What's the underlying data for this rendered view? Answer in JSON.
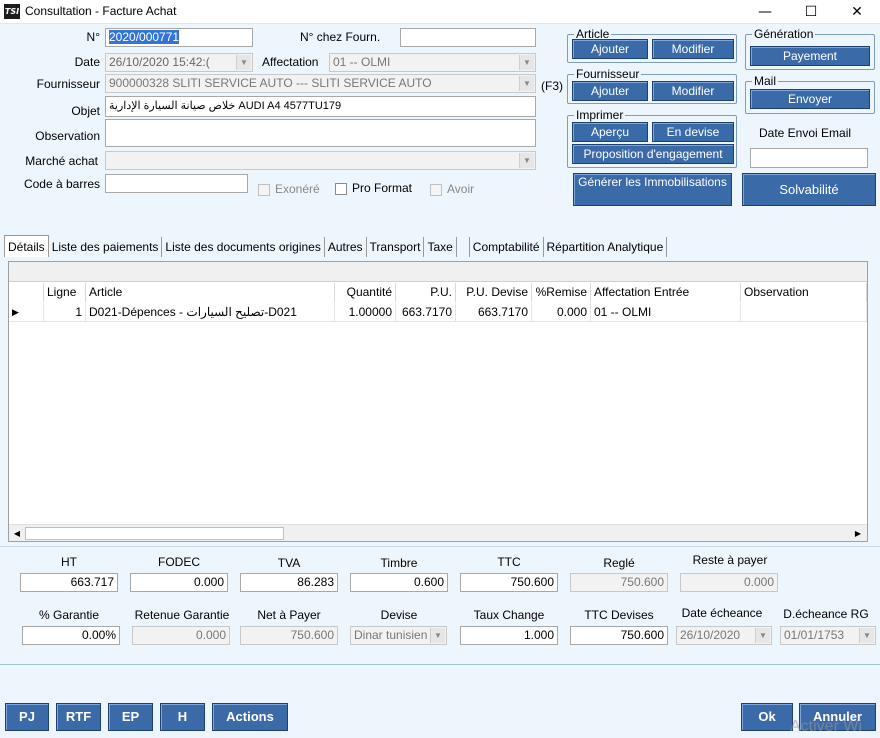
{
  "window": {
    "title": "Consultation - Facture Achat",
    "icon_text": "TSI",
    "minimize_glyph": "—",
    "maximize_glyph": "☐",
    "close_glyph": "✕"
  },
  "form": {
    "numero_label": "N°",
    "numero_value": "2020/000771",
    "num_fourn_label": "N° chez Fourn.",
    "num_fourn_value": "",
    "date_label": "Date",
    "date_value": "26/10/2020 15:42:(",
    "affectation_label": "Affectation",
    "affectation_value": "01 -- OLMI",
    "fournisseur_label": "Fournisseur",
    "fournisseur_value": "900000328 SLITI SERVICE AUTO --- SLITI SERVICE AUTO",
    "f3_label": "(F3)",
    "objet_label": "Objet",
    "objet_value": "خلاص صيانة السيارة الإدارية AUDI A4 4577TU179",
    "observation_label": "Observation",
    "observation_value": "",
    "marche_label": "Marché achat",
    "marche_value": "",
    "code_barres_label": "Code à barres",
    "code_barres_value": "",
    "exonere_label": "Exonéré",
    "pro_format_label": "Pro Format",
    "avoir_label": "Avoir"
  },
  "groups": {
    "article": {
      "title": "Article",
      "ajouter": "Ajouter",
      "modifier": "Modifier"
    },
    "fournisseur": {
      "title": "Fournisseur",
      "ajouter": "Ajouter",
      "modifier": "Modifier"
    },
    "imprimer": {
      "title": "Imprimer",
      "apercu": "Aperçu",
      "en_devise": "En devise",
      "proposition": "Proposition d'engagement"
    },
    "generation": {
      "title": "Génération",
      "payement": "Payement"
    },
    "mail": {
      "title": "Mail",
      "envoyer": "Envoyer"
    }
  },
  "date_envoi_label": "Date Envoi Email",
  "date_envoi_value": "",
  "generer_label": "Générer les Immobilisations",
  "solvabilite_label": "Solvabilité",
  "tabs": [
    "Détails",
    "Liste des paiements",
    "Liste des documents origines",
    "Autres",
    "Transport",
    "Taxe",
    "Comptabilité",
    "Répartition Analytique"
  ],
  "table": {
    "columns": [
      "Ligne",
      "Article",
      "Quantité",
      "P.U.",
      "P.U. Devise",
      "%Remise",
      "Affectation Entrée",
      "Observation"
    ],
    "rows": [
      {
        "marker": "▶",
        "ligne": "1",
        "article": "D021-Dépences - تصليح السيارات-D021",
        "quantite": "1.00000",
        "pu": "663.7170",
        "pu_devise": "663.7170",
        "remise": "0.000",
        "affectation": "01 -- OLMI",
        "observation": ""
      }
    ]
  },
  "totals": {
    "ht_label": "HT",
    "ht": "663.717",
    "fodec_label": "FODEC",
    "fodec": "0.000",
    "tva_label": "TVA",
    "tva": "86.283",
    "timbre_label": "Timbre",
    "timbre": "0.600",
    "ttc_label": "TTC",
    "ttc": "750.600",
    "regle_label": "Reglé",
    "regle": "750.600",
    "reste_label": "Reste à payer",
    "reste": "0.000",
    "garantie_label": "% Garantie",
    "garantie": "0.00%",
    "retenue_label": "Retenue Garantie",
    "retenue": "0.000",
    "net_label": "Net à Payer",
    "net": "750.600",
    "devise_label": "Devise",
    "devise": "Dinar tunisien",
    "taux_label": "Taux Change",
    "taux": "1.000",
    "ttc_devises_label": "TTC Devises",
    "ttc_devises": "750.600",
    "echeance_label": "Date écheance",
    "echeance": "26/10/2020",
    "echeance_rg_label": "D.écheance RG",
    "echeance_rg": "01/01/1753"
  },
  "bottom": {
    "pj": "PJ",
    "rtf": "RTF",
    "ep": "EP",
    "h": "H",
    "actions": "Actions",
    "ok": "Ok",
    "annuler": "Annuler",
    "watermark": "Activer Wi"
  }
}
